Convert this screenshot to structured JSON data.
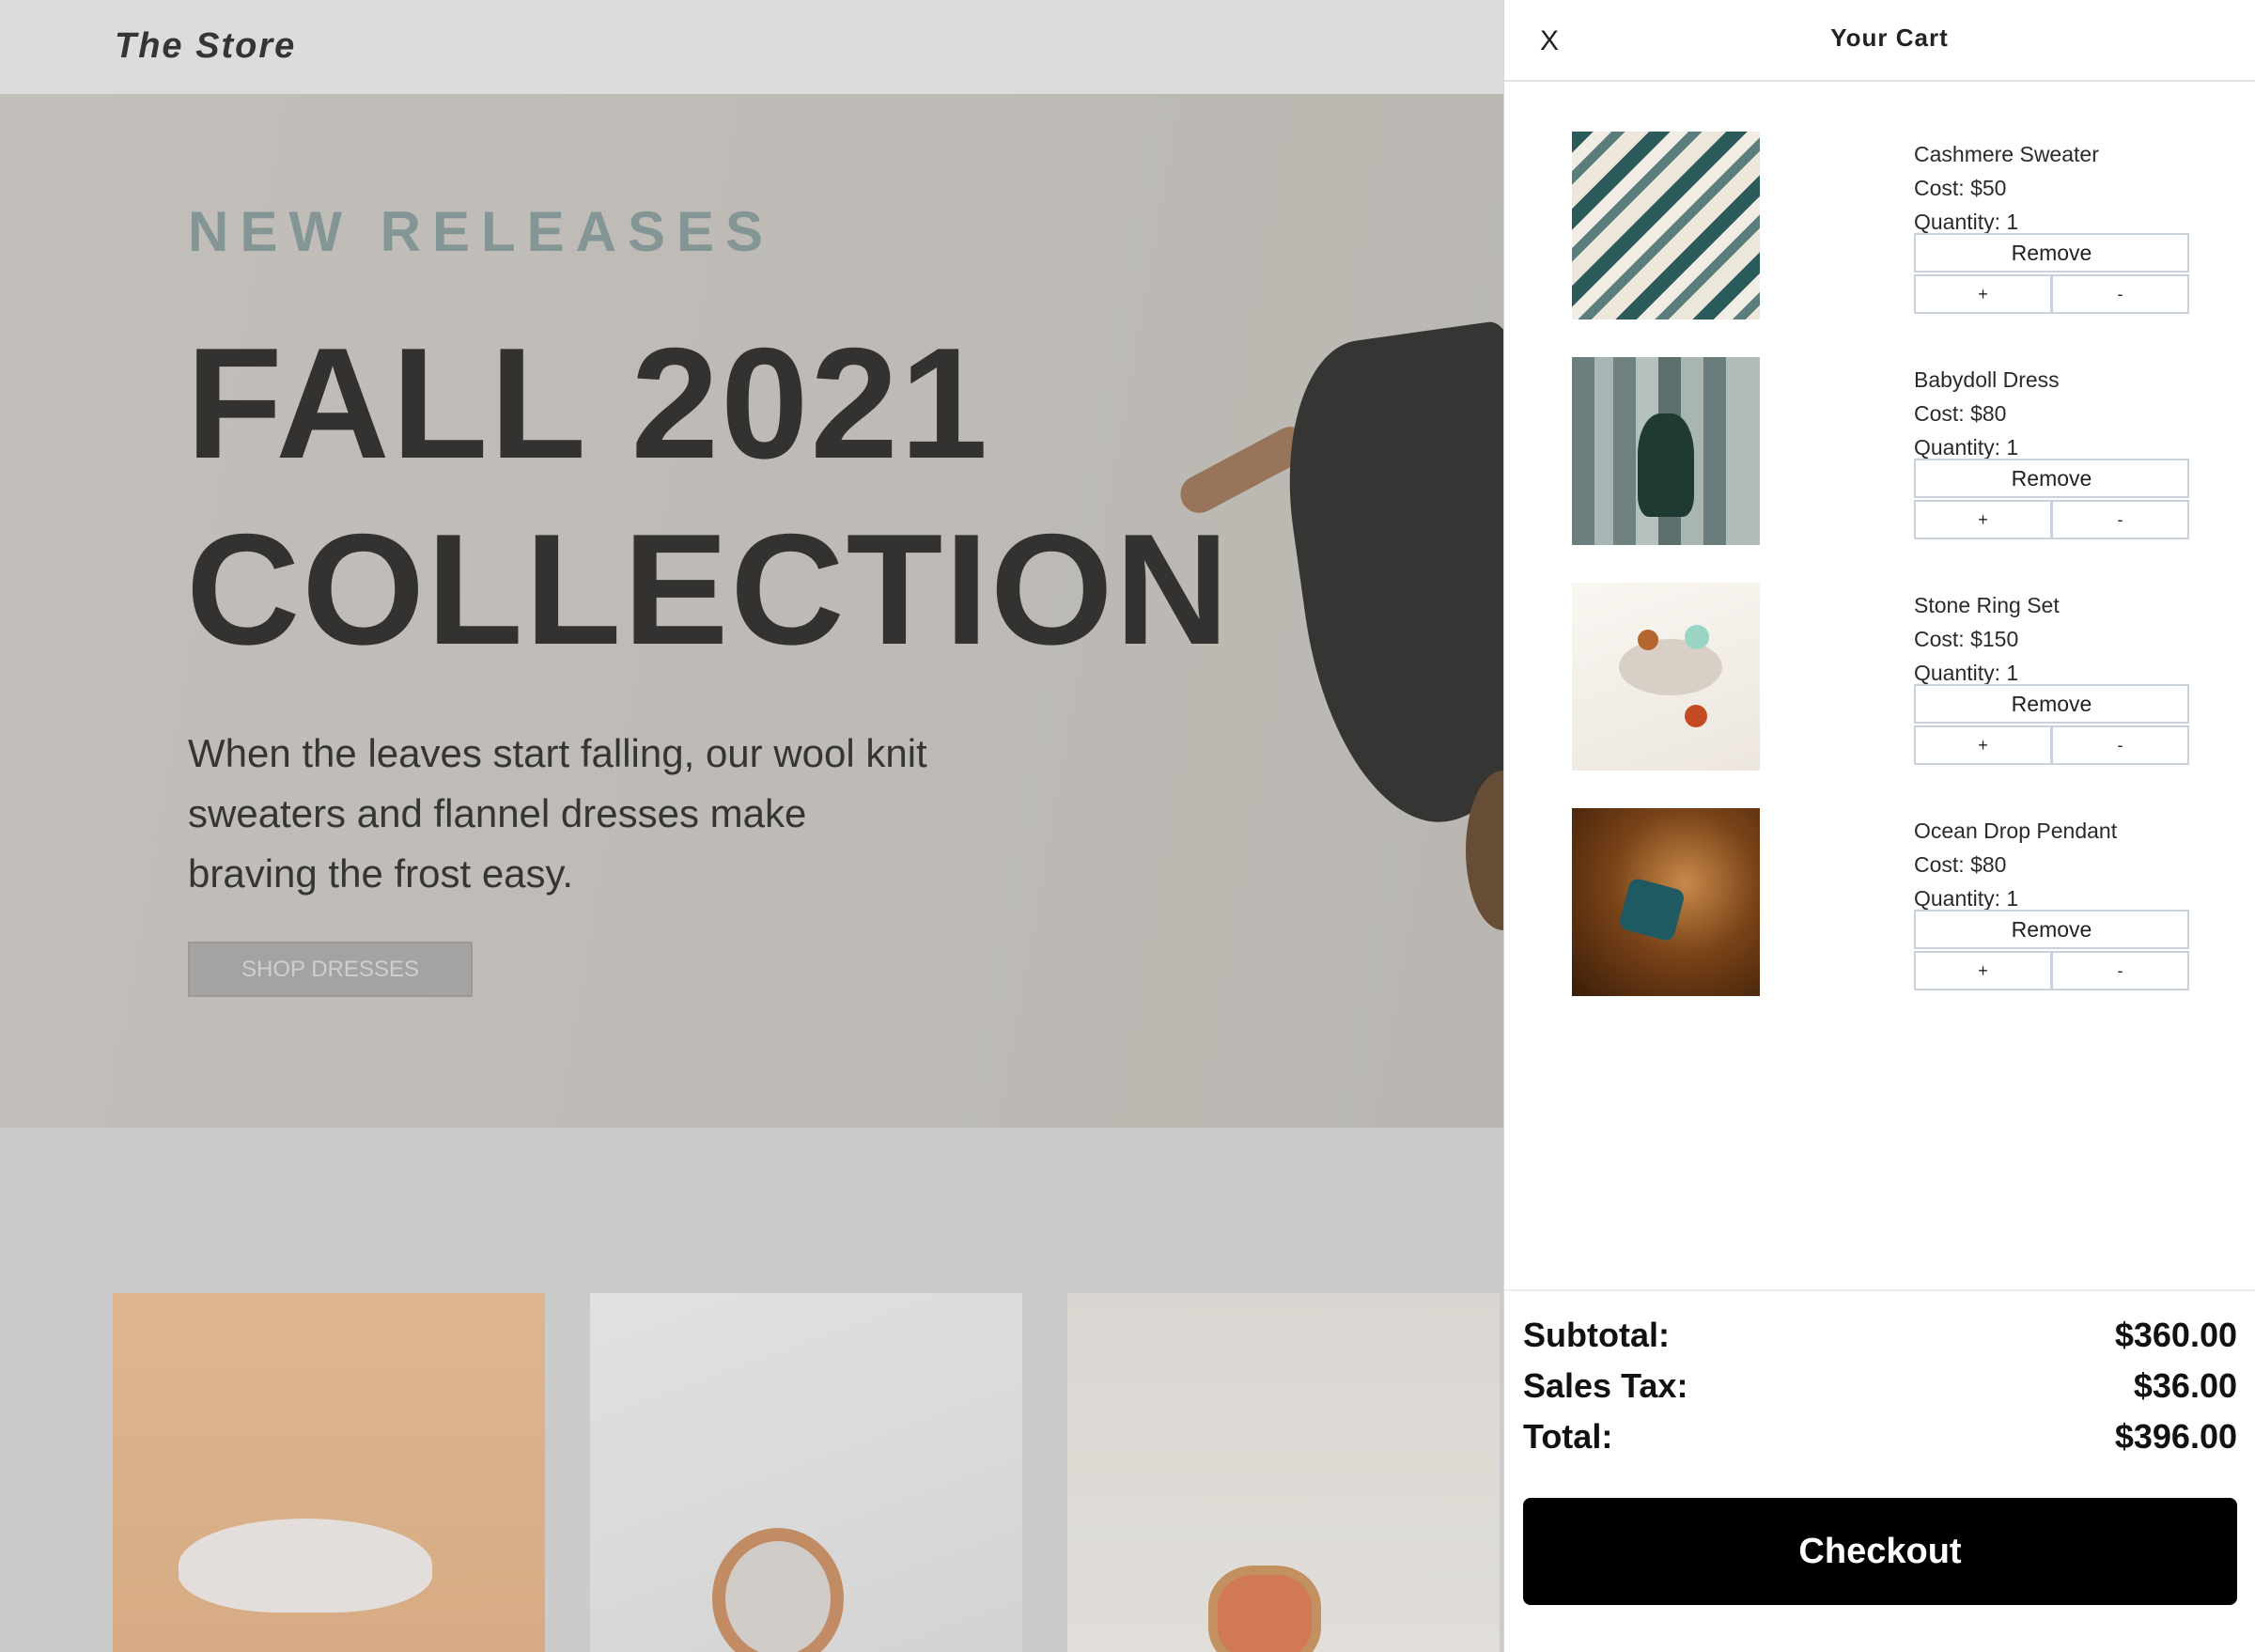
{
  "store": {
    "brand": "The Store",
    "hero": {
      "eyebrow": "NEW RELEASES",
      "title_line1": "FALL 2021",
      "title_line2": "COLLECTION",
      "text": "When the leaves start falling, our wool knit sweaters and flannel dresses make braving the frost easy.",
      "button": "SHOP DRESSES"
    }
  },
  "cart": {
    "close_label": "X",
    "title": "Your Cart",
    "remove_label": "Remove",
    "plus_label": "+",
    "minus_label": "-",
    "items": [
      {
        "name": "Cashmere Sweater",
        "cost": "Cost: $50",
        "quantity": "Quantity: 1",
        "image": "sweater-photo"
      },
      {
        "name": "Babydoll Dress",
        "cost": "Cost: $80",
        "quantity": "Quantity: 1",
        "image": "dress-photo"
      },
      {
        "name": "Stone Ring Set",
        "cost": "Cost: $150",
        "quantity": "Quantity: 1",
        "image": "rings-photo"
      },
      {
        "name": "Ocean Drop Pendant",
        "cost": "Cost: $80",
        "quantity": "Quantity: 1",
        "image": "pendant-photo"
      }
    ],
    "summary": {
      "subtotal_label": "Subtotal:",
      "subtotal_value": "$360.00",
      "tax_label": "Sales Tax:",
      "tax_value": "$36.00",
      "total_label": "Total:",
      "total_value": "$396.00"
    },
    "checkout_label": "Checkout"
  },
  "colors": {
    "accent_eyebrow": "#9fb8b8",
    "checkout_bg": "#000000",
    "button_border": "#c9d1dc"
  }
}
